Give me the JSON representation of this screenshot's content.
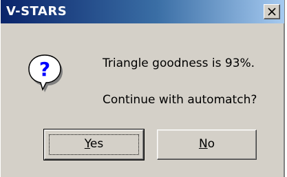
{
  "window": {
    "title": "V-STARS",
    "close_label": "×"
  },
  "dialog": {
    "message_line1": "Triangle goodness is 93%.",
    "message_line2": "Continue with automatch?",
    "icon": "question-icon",
    "buttons": {
      "yes": {
        "accel": "Y",
        "rest": "es"
      },
      "no": {
        "accel": "N",
        "rest": "o"
      }
    }
  },
  "colors": {
    "title_gradient_start": "#0a246a",
    "title_gradient_end": "#a6caf0",
    "face": "#d4d0c8",
    "icon_blue": "#0000ff"
  }
}
